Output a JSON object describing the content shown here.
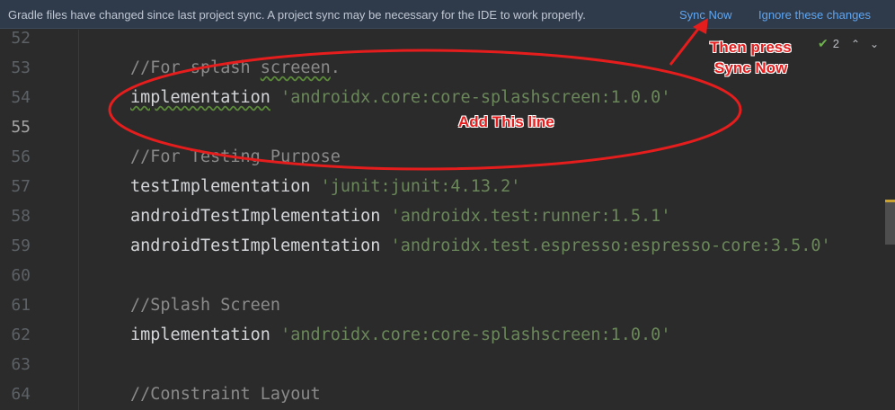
{
  "banner": {
    "message": "Gradle files have changed since last project sync. A project sync may be necessary for the IDE to work properly.",
    "sync_now": "Sync Now",
    "ignore": "Ignore these changes"
  },
  "inspection": {
    "count": "2",
    "up": "^",
    "down": "v"
  },
  "lines": [
    {
      "n": "52",
      "parts": []
    },
    {
      "n": "53",
      "parts": [
        {
          "t": "//For splash screeen.",
          "c": "comment"
        }
      ]
    },
    {
      "n": "54",
      "parts": [
        {
          "t": "implementation",
          "c": "ident"
        },
        {
          "t": " ",
          "c": ""
        },
        {
          "t": "'androidx.core:core-splashscreen:1.0.0'",
          "c": "str"
        }
      ]
    },
    {
      "n": "55",
      "parts": []
    },
    {
      "n": "56",
      "parts": [
        {
          "t": "//For Testing Purpose",
          "c": "comment"
        }
      ]
    },
    {
      "n": "57",
      "parts": [
        {
          "t": "testImplementation",
          "c": "ident"
        },
        {
          "t": " ",
          "c": ""
        },
        {
          "t": "'junit:junit:4.13.2'",
          "c": "str"
        }
      ]
    },
    {
      "n": "58",
      "parts": [
        {
          "t": "androidTestImplementation",
          "c": "ident"
        },
        {
          "t": " ",
          "c": ""
        },
        {
          "t": "'androidx.test:runner:1.5.1'",
          "c": "str"
        }
      ]
    },
    {
      "n": "59",
      "parts": [
        {
          "t": "androidTestImplementation",
          "c": "ident"
        },
        {
          "t": " ",
          "c": ""
        },
        {
          "t": "'androidx.test.espresso:espresso-core:3.5.0'",
          "c": "str"
        }
      ]
    },
    {
      "n": "60",
      "parts": []
    },
    {
      "n": "61",
      "parts": [
        {
          "t": "//Splash Screen",
          "c": "comment"
        }
      ]
    },
    {
      "n": "62",
      "parts": [
        {
          "t": "implementation",
          "c": "ident"
        },
        {
          "t": " ",
          "c": ""
        },
        {
          "t": "'androidx.core:core-splashscreen:1.0.0'",
          "c": "str"
        }
      ]
    },
    {
      "n": "63",
      "parts": []
    },
    {
      "n": "64",
      "parts": [
        {
          "t": "//Constraint Layout",
          "c": "comment"
        }
      ]
    }
  ],
  "current_line": "55",
  "annotations": {
    "add_line": "Add This line",
    "then_press_1": "Then press",
    "then_press_2": "Sync Now",
    "color": "#e51d1d"
  }
}
